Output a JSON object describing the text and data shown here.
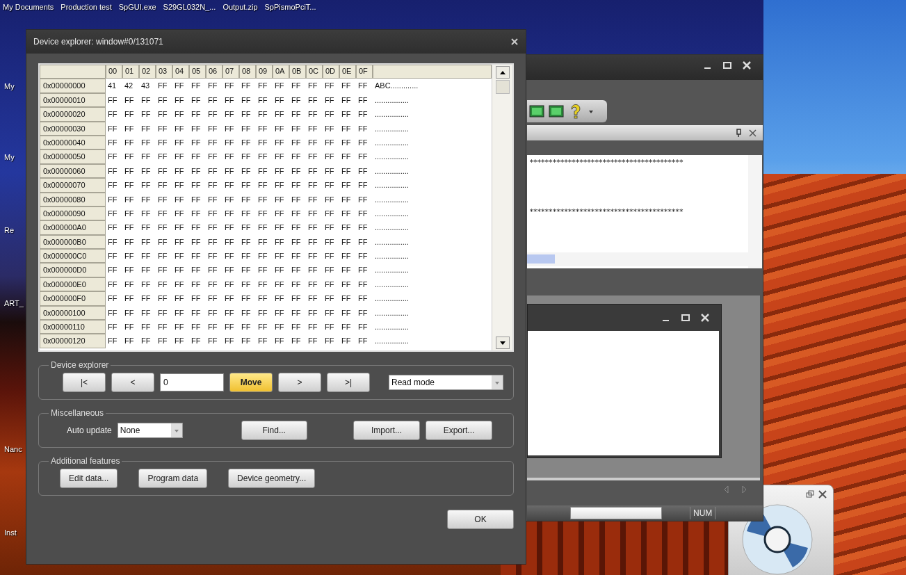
{
  "desktop": {
    "top_icons": [
      "My Documents",
      "Production test",
      "SpGUI.exe",
      "S29GL032N_...",
      "Output.zip",
      "SpPismoPciT..."
    ],
    "left_icons": [
      "My",
      "My",
      "Re",
      "ART_",
      "Nanc",
      "Inst"
    ]
  },
  "background_app": {
    "text_lines": [
      "****************************************",
      "****************************************"
    ],
    "status_bar": {
      "indicator": "NUM"
    }
  },
  "dialog": {
    "title": "Device explorer: window#0/131071",
    "hex_table": {
      "columns": [
        "00",
        "01",
        "02",
        "03",
        "04",
        "05",
        "06",
        "07",
        "08",
        "09",
        "0A",
        "0B",
        "0C",
        "0D",
        "0E",
        "0F"
      ],
      "rows": [
        {
          "address": "0x00000000",
          "bytes": [
            "41",
            "42",
            "43",
            "FF",
            "FF",
            "FF",
            "FF",
            "FF",
            "FF",
            "FF",
            "FF",
            "FF",
            "FF",
            "FF",
            "FF",
            "FF"
          ],
          "ascii": "ABC............."
        },
        {
          "address": "0x00000010",
          "bytes": [
            "FF",
            "FF",
            "FF",
            "FF",
            "FF",
            "FF",
            "FF",
            "FF",
            "FF",
            "FF",
            "FF",
            "FF",
            "FF",
            "FF",
            "FF",
            "FF"
          ],
          "ascii": "................"
        },
        {
          "address": "0x00000020",
          "bytes": [
            "FF",
            "FF",
            "FF",
            "FF",
            "FF",
            "FF",
            "FF",
            "FF",
            "FF",
            "FF",
            "FF",
            "FF",
            "FF",
            "FF",
            "FF",
            "FF"
          ],
          "ascii": "................"
        },
        {
          "address": "0x00000030",
          "bytes": [
            "FF",
            "FF",
            "FF",
            "FF",
            "FF",
            "FF",
            "FF",
            "FF",
            "FF",
            "FF",
            "FF",
            "FF",
            "FF",
            "FF",
            "FF",
            "FF"
          ],
          "ascii": "................"
        },
        {
          "address": "0x00000040",
          "bytes": [
            "FF",
            "FF",
            "FF",
            "FF",
            "FF",
            "FF",
            "FF",
            "FF",
            "FF",
            "FF",
            "FF",
            "FF",
            "FF",
            "FF",
            "FF",
            "FF"
          ],
          "ascii": "................"
        },
        {
          "address": "0x00000050",
          "bytes": [
            "FF",
            "FF",
            "FF",
            "FF",
            "FF",
            "FF",
            "FF",
            "FF",
            "FF",
            "FF",
            "FF",
            "FF",
            "FF",
            "FF",
            "FF",
            "FF"
          ],
          "ascii": "................"
        },
        {
          "address": "0x00000060",
          "bytes": [
            "FF",
            "FF",
            "FF",
            "FF",
            "FF",
            "FF",
            "FF",
            "FF",
            "FF",
            "FF",
            "FF",
            "FF",
            "FF",
            "FF",
            "FF",
            "FF"
          ],
          "ascii": "................"
        },
        {
          "address": "0x00000070",
          "bytes": [
            "FF",
            "FF",
            "FF",
            "FF",
            "FF",
            "FF",
            "FF",
            "FF",
            "FF",
            "FF",
            "FF",
            "FF",
            "FF",
            "FF",
            "FF",
            "FF"
          ],
          "ascii": "................"
        },
        {
          "address": "0x00000080",
          "bytes": [
            "FF",
            "FF",
            "FF",
            "FF",
            "FF",
            "FF",
            "FF",
            "FF",
            "FF",
            "FF",
            "FF",
            "FF",
            "FF",
            "FF",
            "FF",
            "FF"
          ],
          "ascii": "................"
        },
        {
          "address": "0x00000090",
          "bytes": [
            "FF",
            "FF",
            "FF",
            "FF",
            "FF",
            "FF",
            "FF",
            "FF",
            "FF",
            "FF",
            "FF",
            "FF",
            "FF",
            "FF",
            "FF",
            "FF"
          ],
          "ascii": "................"
        },
        {
          "address": "0x000000A0",
          "bytes": [
            "FF",
            "FF",
            "FF",
            "FF",
            "FF",
            "FF",
            "FF",
            "FF",
            "FF",
            "FF",
            "FF",
            "FF",
            "FF",
            "FF",
            "FF",
            "FF"
          ],
          "ascii": "................"
        },
        {
          "address": "0x000000B0",
          "bytes": [
            "FF",
            "FF",
            "FF",
            "FF",
            "FF",
            "FF",
            "FF",
            "FF",
            "FF",
            "FF",
            "FF",
            "FF",
            "FF",
            "FF",
            "FF",
            "FF"
          ],
          "ascii": "................"
        },
        {
          "address": "0x000000C0",
          "bytes": [
            "FF",
            "FF",
            "FF",
            "FF",
            "FF",
            "FF",
            "FF",
            "FF",
            "FF",
            "FF",
            "FF",
            "FF",
            "FF",
            "FF",
            "FF",
            "FF"
          ],
          "ascii": "................"
        },
        {
          "address": "0x000000D0",
          "bytes": [
            "FF",
            "FF",
            "FF",
            "FF",
            "FF",
            "FF",
            "FF",
            "FF",
            "FF",
            "FF",
            "FF",
            "FF",
            "FF",
            "FF",
            "FF",
            "FF"
          ],
          "ascii": "................"
        },
        {
          "address": "0x000000E0",
          "bytes": [
            "FF",
            "FF",
            "FF",
            "FF",
            "FF",
            "FF",
            "FF",
            "FF",
            "FF",
            "FF",
            "FF",
            "FF",
            "FF",
            "FF",
            "FF",
            "FF"
          ],
          "ascii": "................"
        },
        {
          "address": "0x000000F0",
          "bytes": [
            "FF",
            "FF",
            "FF",
            "FF",
            "FF",
            "FF",
            "FF",
            "FF",
            "FF",
            "FF",
            "FF",
            "FF",
            "FF",
            "FF",
            "FF",
            "FF"
          ],
          "ascii": "................"
        },
        {
          "address": "0x00000100",
          "bytes": [
            "FF",
            "FF",
            "FF",
            "FF",
            "FF",
            "FF",
            "FF",
            "FF",
            "FF",
            "FF",
            "FF",
            "FF",
            "FF",
            "FF",
            "FF",
            "FF"
          ],
          "ascii": "................"
        },
        {
          "address": "0x00000110",
          "bytes": [
            "FF",
            "FF",
            "FF",
            "FF",
            "FF",
            "FF",
            "FF",
            "FF",
            "FF",
            "FF",
            "FF",
            "FF",
            "FF",
            "FF",
            "FF",
            "FF"
          ],
          "ascii": "................"
        },
        {
          "address": "0x00000120",
          "bytes": [
            "FF",
            "FF",
            "FF",
            "FF",
            "FF",
            "FF",
            "FF",
            "FF",
            "FF",
            "FF",
            "FF",
            "FF",
            "FF",
            "FF",
            "FF",
            "FF"
          ],
          "ascii": "................"
        }
      ]
    },
    "device_explorer": {
      "title": "Device explorer",
      "prev_buttons": [
        "|<",
        "<"
      ],
      "offset_value": "0",
      "move_button": "Move",
      "next_buttons": [
        ">",
        ">|"
      ],
      "mode_select": "Read mode"
    },
    "miscellaneous": {
      "title": "Miscellaneous",
      "auto_update_label": "Auto update",
      "auto_update_value": "None",
      "find_button": "Find...",
      "file_buttons": [
        "Import...",
        "Export..."
      ]
    },
    "additional_features": {
      "title": "Additional features",
      "buttons": [
        "Edit data...",
        "Program data",
        "Device geometry..."
      ]
    },
    "ok_button": "OK"
  }
}
